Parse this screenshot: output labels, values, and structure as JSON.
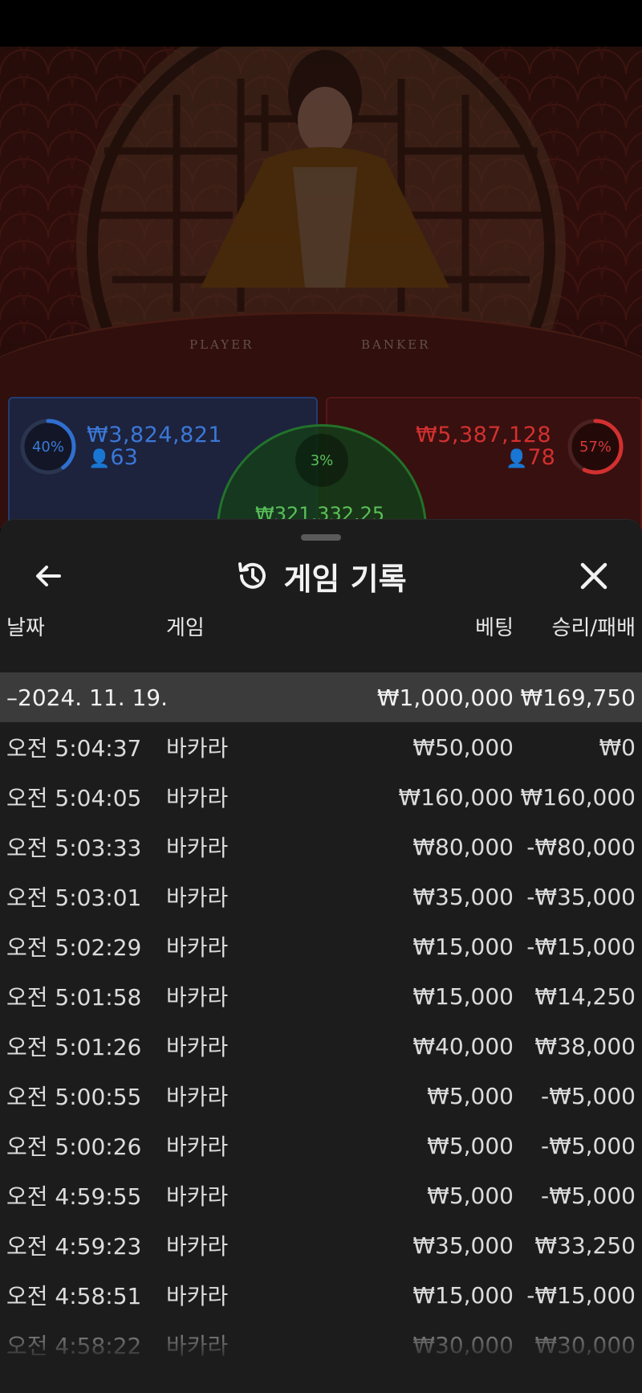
{
  "game_view": {
    "felt_labels": {
      "player": "PLAYER",
      "banker": "BANKER"
    },
    "player_bets": {
      "percent": "40%",
      "percent_value": 0.4,
      "amount": "₩3,824,821",
      "count": "63"
    },
    "banker_bets": {
      "percent": "57%",
      "percent_value": 0.57,
      "amount": "₩5,387,128",
      "count": "78"
    },
    "tie_bets": {
      "percent": "3%",
      "percent_value": 0.03,
      "amount": "₩321,332.25"
    },
    "colors": {
      "player": "#2f6fd0",
      "banker": "#d23030",
      "tie": "#3fb04a"
    }
  },
  "history": {
    "title": "게임 기록",
    "icons": {
      "back": "arrow-left-icon",
      "title": "history-icon",
      "close": "close-icon"
    },
    "columns": {
      "date": "날짜",
      "game": "게임",
      "bet": "베팅",
      "result": "승리/패배"
    },
    "summary": {
      "date": "–2024. 11. 19.",
      "bet": "₩1,000,000",
      "result": "₩169,750"
    },
    "rows": [
      {
        "time": "오전 5:04:37",
        "game": "바카라",
        "bet": "₩50,000",
        "result": "₩0"
      },
      {
        "time": "오전 5:04:05",
        "game": "바카라",
        "bet": "₩160,000",
        "result": "₩160,000"
      },
      {
        "time": "오전 5:03:33",
        "game": "바카라",
        "bet": "₩80,000",
        "result": "-₩80,000"
      },
      {
        "time": "오전 5:03:01",
        "game": "바카라",
        "bet": "₩35,000",
        "result": "-₩35,000"
      },
      {
        "time": "오전 5:02:29",
        "game": "바카라",
        "bet": "₩15,000",
        "result": "-₩15,000"
      },
      {
        "time": "오전 5:01:58",
        "game": "바카라",
        "bet": "₩15,000",
        "result": "₩14,250"
      },
      {
        "time": "오전 5:01:26",
        "game": "바카라",
        "bet": "₩40,000",
        "result": "₩38,000"
      },
      {
        "time": "오전 5:00:55",
        "game": "바카라",
        "bet": "₩5,000",
        "result": "-₩5,000"
      },
      {
        "time": "오전 5:00:26",
        "game": "바카라",
        "bet": "₩5,000",
        "result": "-₩5,000"
      },
      {
        "time": "오전 4:59:55",
        "game": "바카라",
        "bet": "₩5,000",
        "result": "-₩5,000"
      },
      {
        "time": "오전 4:59:23",
        "game": "바카라",
        "bet": "₩35,000",
        "result": "₩33,250"
      },
      {
        "time": "오전 4:58:51",
        "game": "바카라",
        "bet": "₩15,000",
        "result": "-₩15,000"
      },
      {
        "time": "오전 4:58:22",
        "game": "바카라",
        "bet": "₩30,000",
        "result": "₩30,000"
      }
    ]
  }
}
